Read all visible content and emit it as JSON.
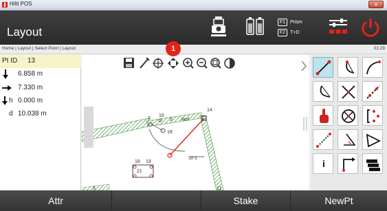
{
  "window": {
    "title": "Hilti POS",
    "close_label": "x"
  },
  "header": {
    "title": "Layout",
    "f1_key": "F1",
    "f1_label": "Prism",
    "f2_key": "F2",
    "f2_label": "T+D"
  },
  "breadcrumb": {
    "path": "Home | Layout | Select Point | Layout",
    "time": "01:29"
  },
  "info": {
    "pt_id_label": "Pt ID",
    "pt_id": "13",
    "down_value": "6.858 m",
    "right_value": "7.330 m",
    "h_label": "h",
    "h_value": "0.000 m",
    "d_label": "d",
    "d_value": "10.038 m"
  },
  "callout": {
    "number": "1"
  },
  "map": {
    "labels": {
      "p3": "3",
      "p16": "16",
      "p5": "5",
      "ref": "Ref",
      "p14": "14",
      "p18a": "18",
      "p18b": "18",
      "p19": "19",
      "p21": "21",
      "st": "St-1",
      "p13": "13",
      "p5b": "5",
      "p11": "11",
      "p13b": "13"
    }
  },
  "tools": {
    "icons": [
      "line-icon",
      "arc-icon",
      "curve-icon",
      "arc-left-icon",
      "intersect-icon",
      "offset-line-icon",
      "hand-point-icon",
      "target-icon",
      "bracket-points-icon",
      "dashed-line-icon",
      "angle-icon",
      "polygon-icon",
      "info-icon",
      "axis-icon",
      "layers-icon"
    ],
    "info_glyph": "i"
  },
  "footer": {
    "attr": "Attr",
    "stake": "Stake",
    "newpt": "NewPt"
  },
  "colors": {
    "accent": "#e2231a",
    "header": "#333333",
    "highlight": "#f7f3c8",
    "active_tool": "#bfe3ec"
  }
}
